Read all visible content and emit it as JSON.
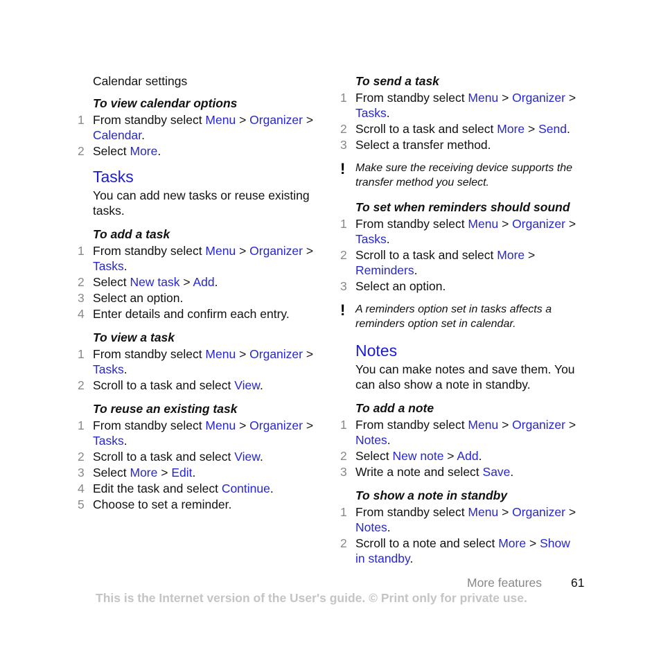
{
  "left": {
    "calendar_settings": {
      "heading": "Calendar settings",
      "view_options": {
        "title": "To view calendar options",
        "steps": [
          {
            "n": "1",
            "parts": [
              {
                "t": "From standby select "
              },
              {
                "l": "Menu"
              },
              {
                "t": " > "
              },
              {
                "l": "Organizer"
              },
              {
                "t": " > "
              },
              {
                "l": "Calendar"
              },
              {
                "t": "."
              }
            ]
          },
          {
            "n": "2",
            "parts": [
              {
                "t": "Select "
              },
              {
                "l": "More"
              },
              {
                "t": "."
              }
            ]
          }
        ]
      }
    },
    "tasks": {
      "heading": "Tasks",
      "intro": "You can add new tasks or reuse existing tasks.",
      "add": {
        "title": "To add a task",
        "steps": [
          {
            "n": "1",
            "parts": [
              {
                "t": "From standby select "
              },
              {
                "l": "Menu"
              },
              {
                "t": " > "
              },
              {
                "l": "Organizer"
              },
              {
                "t": " > "
              },
              {
                "l": "Tasks"
              },
              {
                "t": "."
              }
            ]
          },
          {
            "n": "2",
            "parts": [
              {
                "t": "Select "
              },
              {
                "l": "New task"
              },
              {
                "t": " > "
              },
              {
                "l": "Add"
              },
              {
                "t": "."
              }
            ]
          },
          {
            "n": "3",
            "parts": [
              {
                "t": "Select an option."
              }
            ]
          },
          {
            "n": "4",
            "parts": [
              {
                "t": "Enter details and confirm each entry."
              }
            ]
          }
        ]
      },
      "view": {
        "title": "To view a task",
        "steps": [
          {
            "n": "1",
            "parts": [
              {
                "t": "From standby select "
              },
              {
                "l": "Menu"
              },
              {
                "t": " > "
              },
              {
                "l": "Organizer"
              },
              {
                "t": " > "
              },
              {
                "l": "Tasks"
              },
              {
                "t": "."
              }
            ]
          },
          {
            "n": "2",
            "parts": [
              {
                "t": "Scroll to a task and select "
              },
              {
                "l": "View"
              },
              {
                "t": "."
              }
            ]
          }
        ]
      },
      "reuse": {
        "title": "To reuse an existing task",
        "steps": [
          {
            "n": "1",
            "parts": [
              {
                "t": "From standby select "
              },
              {
                "l": "Menu"
              },
              {
                "t": " > "
              },
              {
                "l": "Organizer"
              },
              {
                "t": " > "
              },
              {
                "l": "Tasks"
              },
              {
                "t": "."
              }
            ]
          },
          {
            "n": "2",
            "parts": [
              {
                "t": "Scroll to a task and select "
              },
              {
                "l": "View"
              },
              {
                "t": "."
              }
            ]
          },
          {
            "n": "3",
            "parts": [
              {
                "t": "Select "
              },
              {
                "l": "More"
              },
              {
                "t": " > "
              },
              {
                "l": "Edit"
              },
              {
                "t": "."
              }
            ]
          },
          {
            "n": "4",
            "parts": [
              {
                "t": "Edit the task and select "
              },
              {
                "l": "Continue"
              },
              {
                "t": "."
              }
            ]
          },
          {
            "n": "5",
            "parts": [
              {
                "t": "Choose to set a reminder."
              }
            ]
          }
        ]
      }
    }
  },
  "right": {
    "send": {
      "title": "To send a task",
      "steps": [
        {
          "n": "1",
          "parts": [
            {
              "t": "From standby select "
            },
            {
              "l": "Menu"
            },
            {
              "t": " > "
            },
            {
              "l": "Organizer"
            },
            {
              "t": " > "
            },
            {
              "l": "Tasks"
            },
            {
              "t": "."
            }
          ]
        },
        {
          "n": "2",
          "parts": [
            {
              "t": "Scroll to a task and select "
            },
            {
              "l": "More"
            },
            {
              "t": " > "
            },
            {
              "l": "Send"
            },
            {
              "t": "."
            }
          ]
        },
        {
          "n": "3",
          "parts": [
            {
              "t": "Select a transfer method."
            }
          ]
        }
      ],
      "note": "Make sure the receiving device supports the transfer method you select."
    },
    "reminders": {
      "title": "To set when reminders should sound",
      "steps": [
        {
          "n": "1",
          "parts": [
            {
              "t": "From standby select "
            },
            {
              "l": "Menu"
            },
            {
              "t": " > "
            },
            {
              "l": "Organizer"
            },
            {
              "t": " > "
            },
            {
              "l": "Tasks"
            },
            {
              "t": "."
            }
          ]
        },
        {
          "n": "2",
          "parts": [
            {
              "t": "Scroll to a task and select "
            },
            {
              "l": "More"
            },
            {
              "t": " > "
            },
            {
              "l": "Reminders"
            },
            {
              "t": "."
            }
          ]
        },
        {
          "n": "3",
          "parts": [
            {
              "t": "Select an option."
            }
          ]
        }
      ],
      "note": "A reminders option set in tasks affects a reminders option set in calendar."
    },
    "notes": {
      "heading": "Notes",
      "intro": "You can make notes and save them. You can also show a note in standby.",
      "add": {
        "title": "To add a note",
        "steps": [
          {
            "n": "1",
            "parts": [
              {
                "t": "From standby select "
              },
              {
                "l": "Menu"
              },
              {
                "t": " > "
              },
              {
                "l": "Organizer"
              },
              {
                "t": " > "
              },
              {
                "l": "Notes"
              },
              {
                "t": "."
              }
            ]
          },
          {
            "n": "2",
            "parts": [
              {
                "t": "Select "
              },
              {
                "l": "New note"
              },
              {
                "t": " > "
              },
              {
                "l": "Add"
              },
              {
                "t": "."
              }
            ]
          },
          {
            "n": "3",
            "parts": [
              {
                "t": "Write a note and select "
              },
              {
                "l": "Save"
              },
              {
                "t": "."
              }
            ]
          }
        ]
      },
      "show": {
        "title": "To show a note in standby",
        "steps": [
          {
            "n": "1",
            "parts": [
              {
                "t": "From standby select "
              },
              {
                "l": "Menu"
              },
              {
                "t": " > "
              },
              {
                "l": "Organizer"
              },
              {
                "t": " > "
              },
              {
                "l": "Notes"
              },
              {
                "t": "."
              }
            ]
          },
          {
            "n": "2",
            "parts": [
              {
                "t": "Scroll to a note and select "
              },
              {
                "l": "More"
              },
              {
                "t": " > "
              },
              {
                "l": "Show in standby"
              },
              {
                "t": "."
              }
            ]
          }
        ]
      }
    }
  },
  "footer": {
    "section": "More features",
    "page": "61",
    "disclaimer": "This is the Internet version of the User's guide. © Print only for private use."
  },
  "colors": {
    "link": "#2727d1",
    "heading": "#1b1bd6",
    "step_number": "#888888",
    "disclaimer": "#c4c4c4"
  }
}
